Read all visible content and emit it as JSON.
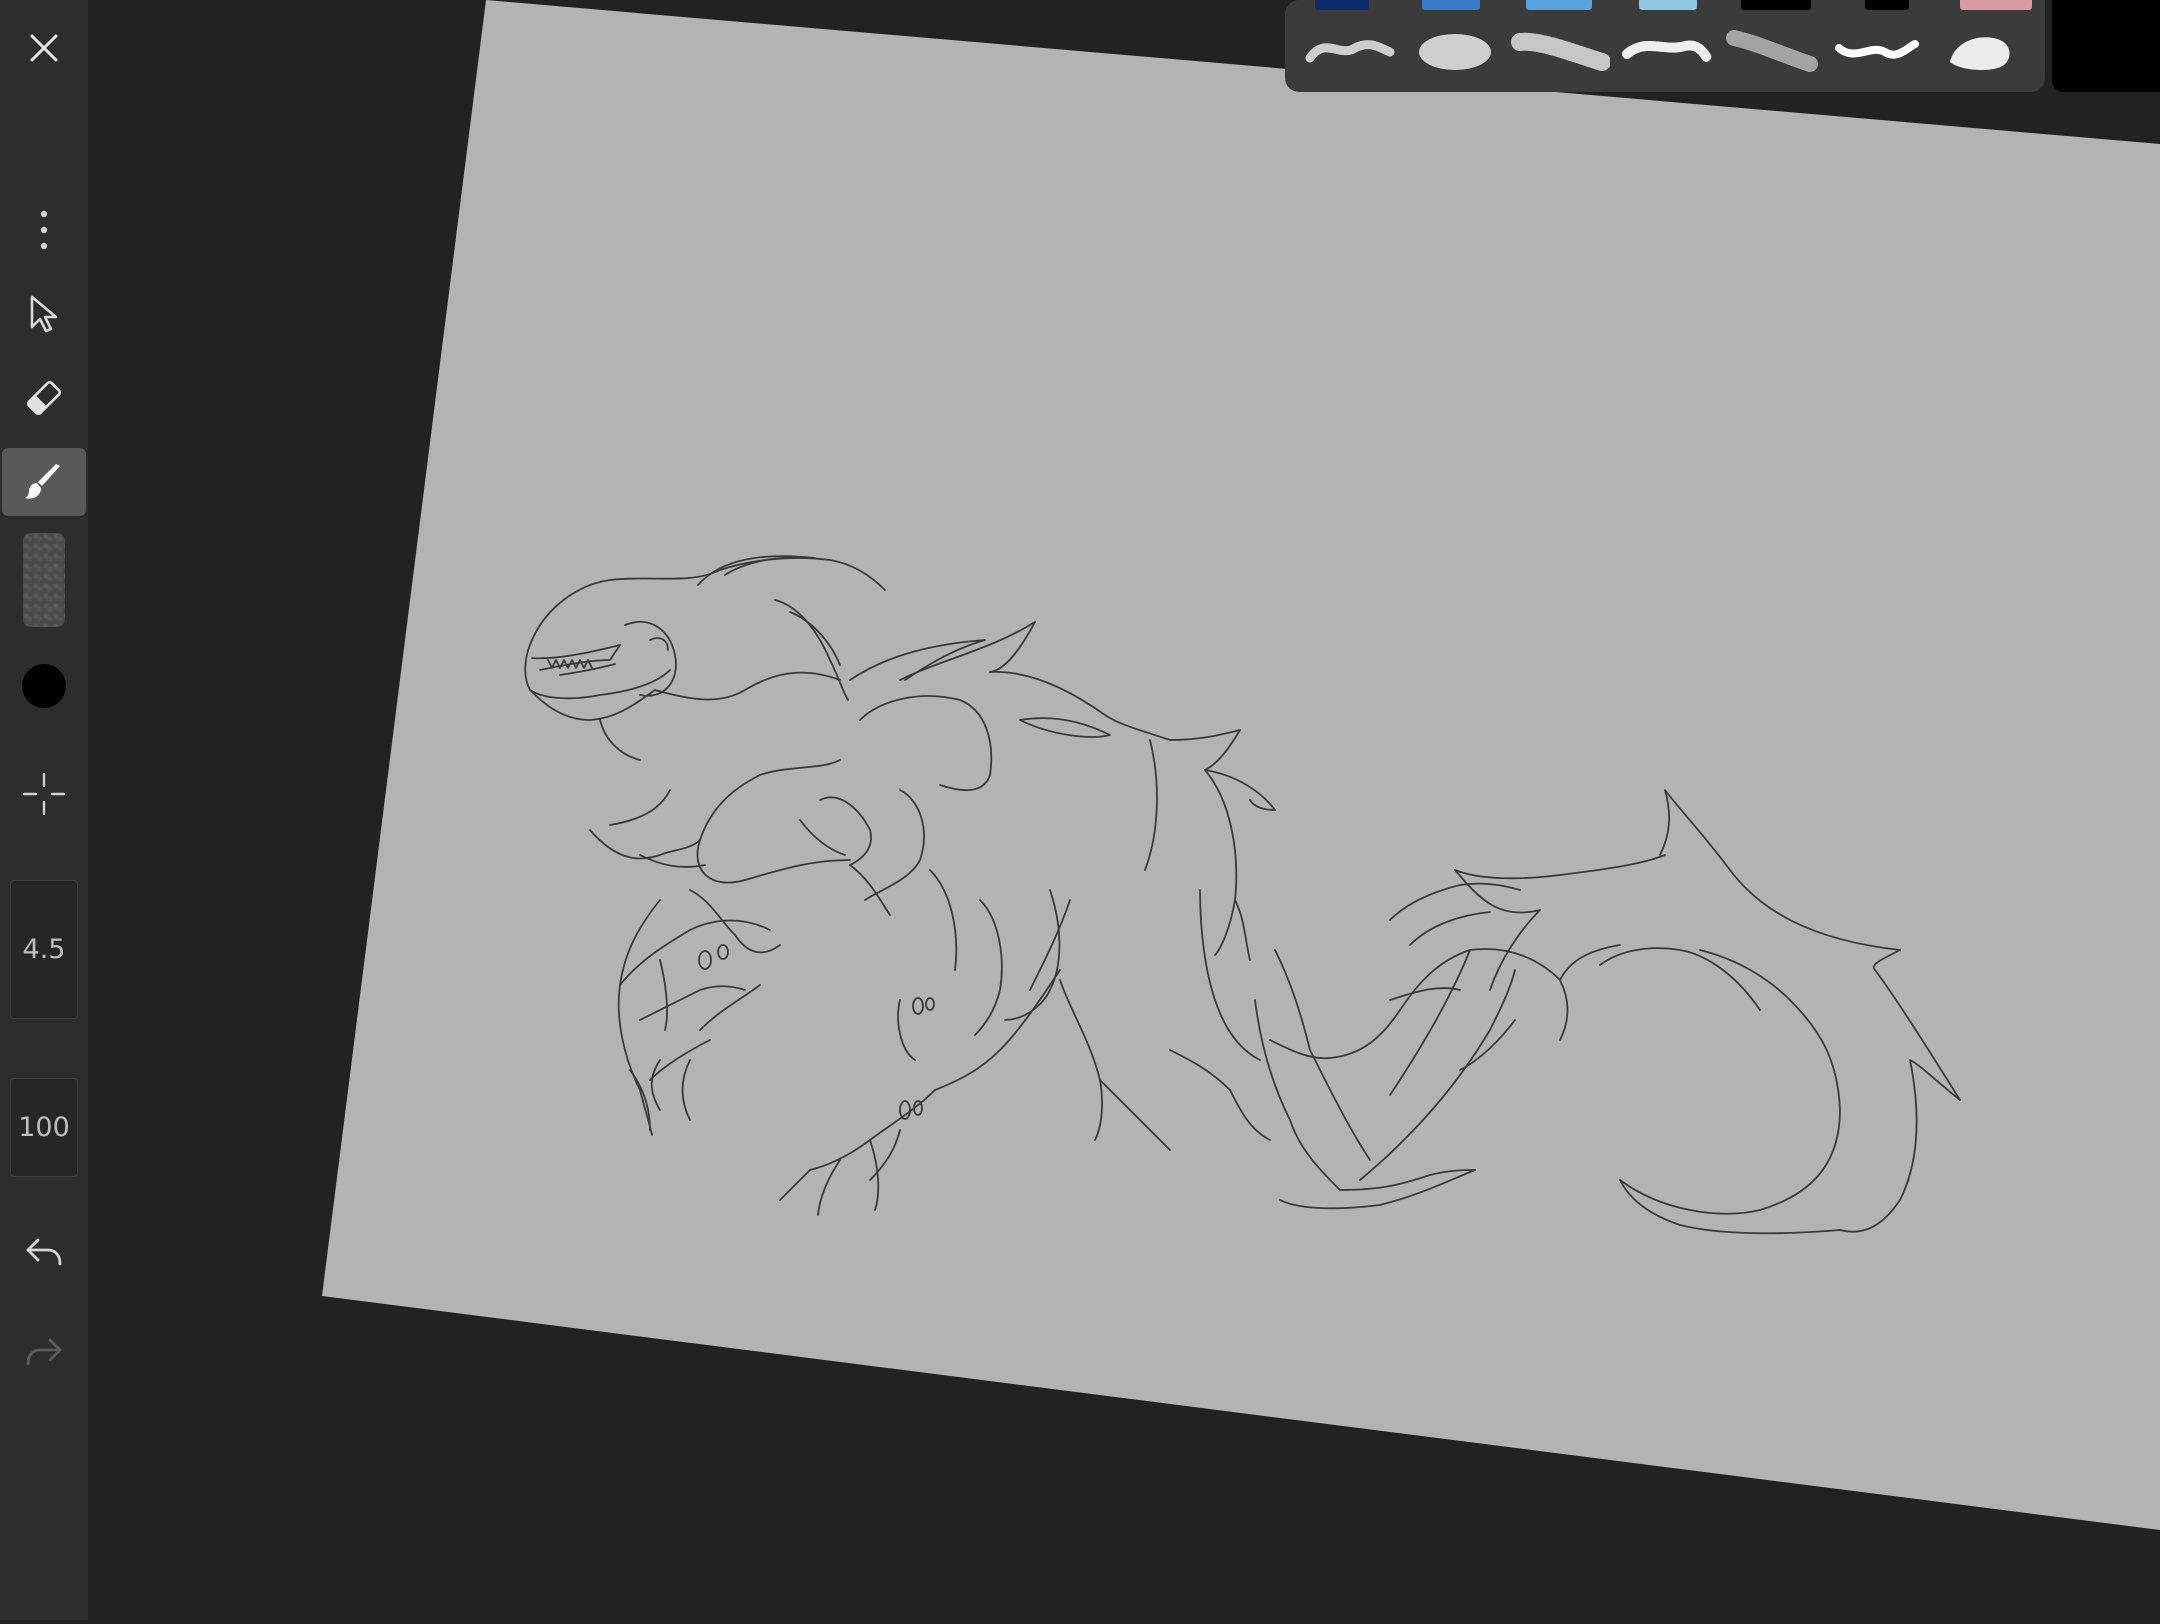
{
  "sidebar": {
    "close_icon": "close-icon",
    "more_icon": "more-vertical-icon",
    "select_icon": "cursor-arrow-icon",
    "eraser_icon": "eraser-icon",
    "brush_icon": "paintbrush-icon",
    "crosshair_icon": "crosshair-icon",
    "undo_icon": "undo-icon",
    "redo_icon": "redo-icon",
    "brush_size": "4.5",
    "brush_opacity": "100",
    "active_color": "#000000"
  },
  "palette": {
    "swatches": [
      {
        "color": "#0d2b6b"
      },
      {
        "color": "#3a7bc8"
      },
      {
        "color": "#5aa2db"
      },
      {
        "color": "#8fc6e0"
      },
      {
        "color": "#000000"
      },
      {
        "color": "#000000"
      },
      {
        "color": "#d79aa2"
      }
    ],
    "brushes": [
      "soft-stroke-brush",
      "airbrush-blob-brush",
      "spray-brush",
      "chalk-brush",
      "smudge-brush",
      "ink-brush",
      "round-blob-brush"
    ],
    "current_color": "#000000"
  },
  "canvas": {
    "paper_color": "#b3b3b3",
    "background_color": "#222222",
    "sketch_color": "#3a3a3a"
  }
}
